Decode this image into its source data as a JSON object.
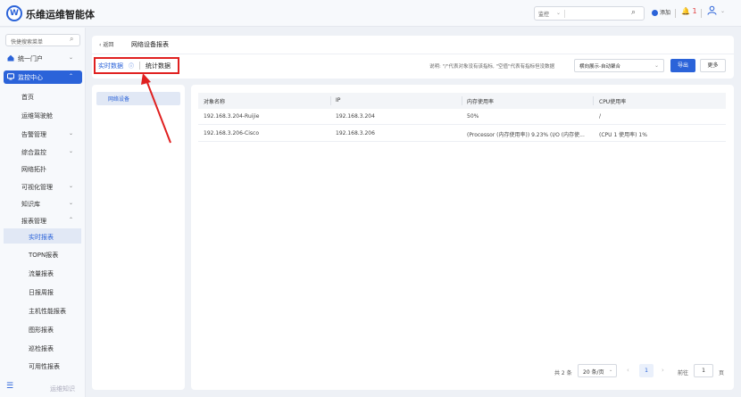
{
  "topbar": {
    "logo_letter": "W",
    "app_title": "乐维运维智能体",
    "search_scope": "监控",
    "add_label": "添加",
    "alert_count": "1"
  },
  "sidebar": {
    "search_placeholder": "快捷搜索菜单",
    "groups": [
      {
        "label": "统一门户"
      },
      {
        "label": "监控中心"
      }
    ],
    "items": [
      {
        "label": "首页",
        "caret": ""
      },
      {
        "label": "运维驾驶舱",
        "caret": ""
      },
      {
        "label": "告警管理",
        "caret": "⌄"
      },
      {
        "label": "综合监控",
        "caret": "⌄"
      },
      {
        "label": "网络拓扑",
        "caret": ""
      },
      {
        "label": "可视化管理",
        "caret": "⌄"
      },
      {
        "label": "知识库",
        "caret": "⌄"
      },
      {
        "label": "报表管理",
        "caret": "⌃"
      }
    ],
    "sub_items": [
      {
        "label": "实时报表"
      },
      {
        "label": "TOPN报表"
      },
      {
        "label": "流量报表"
      },
      {
        "label": "日报周报"
      },
      {
        "label": "主机性能报表"
      },
      {
        "label": "图形报表"
      },
      {
        "label": "巡检报表"
      },
      {
        "label": "可用性报表"
      }
    ],
    "footer_label": "运维知识"
  },
  "header": {
    "back_label": "返回",
    "page_title": "网络设备报表",
    "tabs": [
      {
        "label": "实时数据"
      },
      {
        "label": "统计数据"
      }
    ],
    "note": "说明: \"/\"代表对象没有该指标, \"空值\"代表有指标但没数据",
    "display_mode": "横向展示-自动聚合",
    "export_label": "导出",
    "more_label": "更多"
  },
  "left_panel": {
    "items": [
      {
        "label": "网络设备"
      }
    ]
  },
  "table": {
    "columns": [
      "对象名称",
      "IP",
      "内存使用率",
      "CPU使用率"
    ],
    "rows": [
      [
        "192.168.3.204-Ruijie",
        "192.168.3.204",
        "50%",
        "/"
      ],
      [
        "192.168.3.206-Cisco",
        "192.168.3.206",
        "(Processor (内存使用率)) 9.23% (I/O (内存使...",
        "(CPU 1 使用率) 1%"
      ]
    ]
  },
  "pagination": {
    "total": "共 2 条",
    "page_size": "20 条/页",
    "current_page": "1",
    "goto_label": "前往",
    "goto_value": "1",
    "page_unit": "页"
  },
  "colors": {
    "accent": "#2b63d9",
    "highlight": "#e02020"
  }
}
